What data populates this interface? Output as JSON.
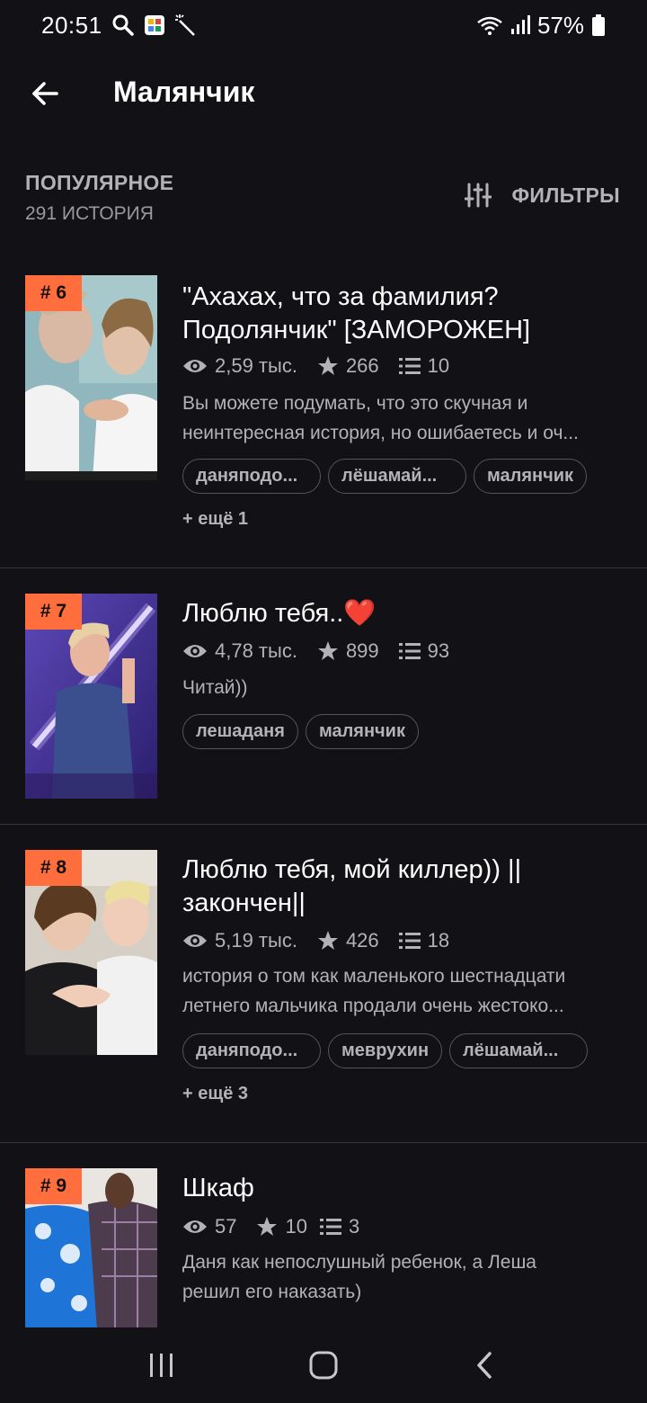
{
  "status": {
    "time": "20:51",
    "battery": "57%"
  },
  "header": {
    "title": "Малянчик"
  },
  "section": {
    "title": "ПОПУЛЯРНОЕ",
    "count": "291 ИСТОРИЯ",
    "filters_label": "ФИЛЬТРЫ"
  },
  "stories": [
    {
      "rank": "# 6",
      "title_line1": "\"Ахахах, что за фамилия?",
      "title_line2": "Подолянчик\" [ЗАМОРОЖЕН]",
      "views": "2,59 тыс.",
      "votes": "266",
      "parts": "10",
      "desc_line1": "Вы можете подумать, что это скучная и",
      "desc_line2": "неинтересная история, но ошибаетесь и оч...",
      "tags": [
        "даняподо...",
        "лёшамай...",
        "малянчик"
      ],
      "more": "+ ещё 1"
    },
    {
      "rank": "# 7",
      "title_line1": "Люблю тебя..❤️",
      "views": "4,78 тыс.",
      "votes": "899",
      "parts": "93",
      "desc_line1": "Читай))",
      "tags": [
        "лешаданя",
        "малянчик"
      ]
    },
    {
      "rank": "# 8",
      "title_line1": "Люблю тебя, мой киллер)) ||",
      "title_line2": "закончен||",
      "views": "5,19 тыс.",
      "votes": "426",
      "parts": "18",
      "desc_line1": "история о том как маленького шестнадцати",
      "desc_line2": "летнего мальчика продали очень жестоко...",
      "tags": [
        "даняподо...",
        "меврухин",
        "лёшамай..."
      ],
      "more": "+ ещё 3"
    },
    {
      "rank": "# 9",
      "title_line1": "Шкаф",
      "views": "57",
      "votes": "10",
      "parts": "3",
      "desc_line1": "Даня как непослушный ребенок, а Леша",
      "desc_line2": "решил его наказать)"
    }
  ],
  "colors": {
    "background": "#121115",
    "rank_badge": "#ff6e3c",
    "text_secondary": "#b3b3b6",
    "divider": "#38373c"
  },
  "icons": [
    "search-icon",
    "photo-app-icon",
    "magic-wand-icon",
    "wifi-icon",
    "signal-icon",
    "battery-icon",
    "back-arrow-icon",
    "filter-sliders-icon",
    "eye-icon",
    "star-icon",
    "list-icon",
    "recents-icon",
    "home-icon",
    "nav-back-icon"
  ]
}
